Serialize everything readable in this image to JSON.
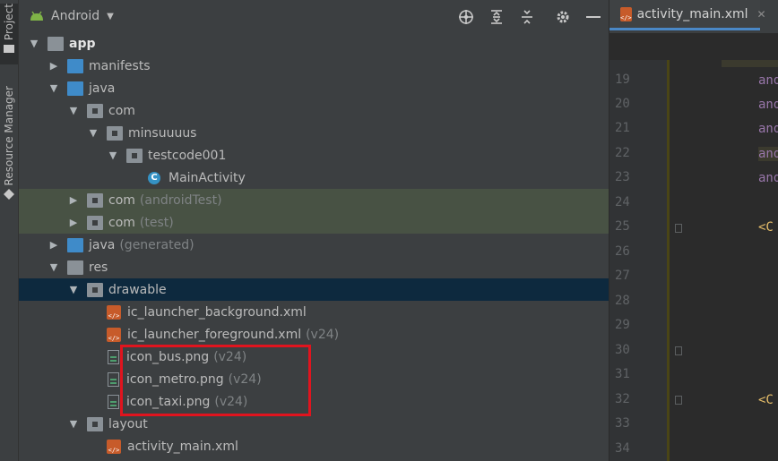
{
  "tool_strip": {
    "project_label": "Project",
    "resource_manager_label": "Resource Manager"
  },
  "panel": {
    "view_selector": "Android",
    "tree": [
      {
        "label": "app",
        "suffix": ""
      },
      {
        "label": "manifests",
        "suffix": ""
      },
      {
        "label": "java",
        "suffix": ""
      },
      {
        "label": "com",
        "suffix": ""
      },
      {
        "label": "minsuuuus",
        "suffix": ""
      },
      {
        "label": "testcode001",
        "suffix": ""
      },
      {
        "label": "MainActivity",
        "suffix": ""
      },
      {
        "label": "com",
        "suffix": "(androidTest)"
      },
      {
        "label": "com",
        "suffix": "(test)"
      },
      {
        "label": "java",
        "suffix": "(generated)"
      },
      {
        "label": "res",
        "suffix": ""
      },
      {
        "label": "drawable",
        "suffix": ""
      },
      {
        "label": "ic_launcher_background.xml",
        "suffix": ""
      },
      {
        "label": "ic_launcher_foreground.xml",
        "suffix": "(v24)"
      },
      {
        "label": "icon_bus.png",
        "suffix": "(v24)"
      },
      {
        "label": "icon_metro.png",
        "suffix": "(v24)"
      },
      {
        "label": "icon_taxi.png",
        "suffix": "(v24)"
      },
      {
        "label": "layout",
        "suffix": ""
      },
      {
        "label": "activity_main.xml",
        "suffix": ""
      }
    ],
    "class_badge": "C",
    "xml_badge": "</>"
  },
  "editor": {
    "tab_label": "activity_main.xml",
    "line_numbers": [
      "19",
      "20",
      "21",
      "22",
      "23",
      "24",
      "25",
      "26",
      "27",
      "28",
      "29",
      "30",
      "31",
      "32",
      "33",
      "34"
    ],
    "code": {
      "l19": "and",
      "l20": "and",
      "l21": "and",
      "l22": "and",
      "l23": "and",
      "l25": "<C",
      "l32": "<C"
    }
  },
  "colors": {
    "selection": "#0d293e",
    "test_rows": "#485244",
    "highlight_box": "#e0141e",
    "tab_underline": "#4a88c7"
  }
}
